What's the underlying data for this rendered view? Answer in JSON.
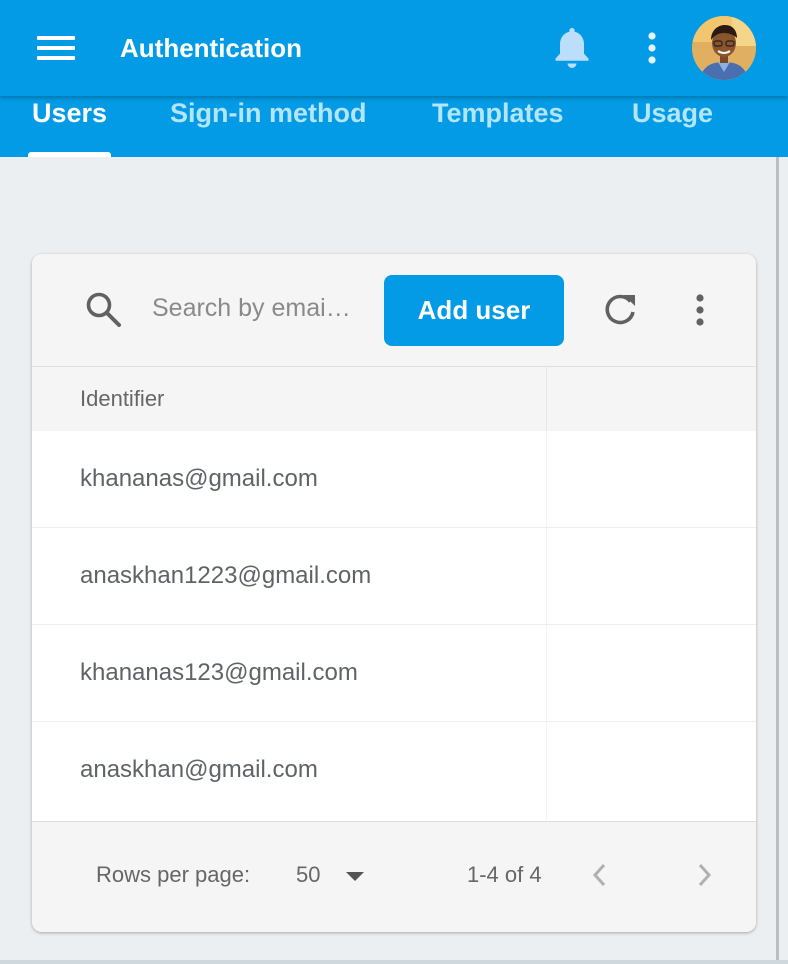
{
  "appbar": {
    "title": "Authentication",
    "colors": {
      "primary": "#039be5",
      "tab_inactive": "#b3e5fc"
    }
  },
  "tabs": [
    {
      "label": "Users",
      "active": true
    },
    {
      "label": "Sign-in method",
      "active": false
    },
    {
      "label": "Templates",
      "active": false
    },
    {
      "label": "Usage",
      "active": false
    }
  ],
  "toolbar": {
    "search_placeholder": "Search by emai…",
    "add_user_label": "Add user"
  },
  "table": {
    "columns": [
      "Identifier"
    ],
    "rows": [
      {
        "identifier": "khananas@gmail.com"
      },
      {
        "identifier": "anaskhan1223@gmail.com"
      },
      {
        "identifier": "khananas123@gmail.com"
      },
      {
        "identifier": "anaskhan@gmail.com"
      }
    ]
  },
  "pagination": {
    "rows_per_page_label": "Rows per page:",
    "rows_per_page_value": "50",
    "range_text": "1-4 of 4"
  },
  "icons": [
    "menu-icon",
    "bell-icon",
    "more-vert-icon",
    "avatar",
    "search-icon",
    "refresh-icon",
    "chevron-left-icon",
    "chevron-right-icon",
    "dropdown-arrow-icon"
  ]
}
